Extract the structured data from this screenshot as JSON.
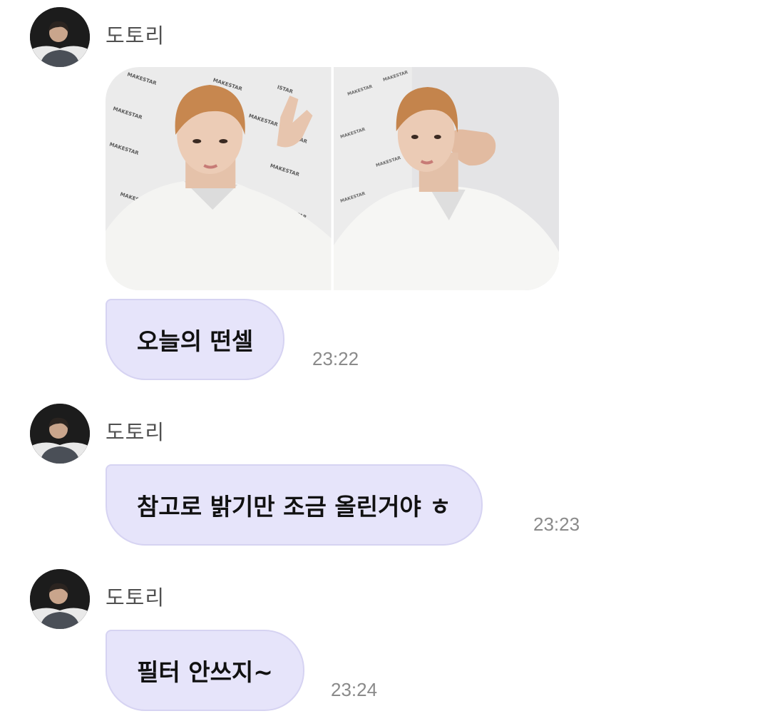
{
  "messages": [
    {
      "sender": "도토리",
      "avatar_icon": "profile-avatar",
      "photos": [
        "selfie-peace-sign",
        "selfie-fist-pose"
      ],
      "text": "오늘의 떤셀",
      "time": "23:22"
    },
    {
      "sender": "도토리",
      "avatar_icon": "profile-avatar",
      "text": "참고로 밝기만 조금 올린거야 ㅎ",
      "time": "23:23"
    },
    {
      "sender": "도토리",
      "avatar_icon": "profile-avatar",
      "text": "필터 안쓰지~",
      "time": "23:24"
    }
  ],
  "colors": {
    "bubble_bg": "#e6e4fa",
    "bubble_border": "#d6d3f2",
    "sender_text": "#505050",
    "time_text": "#8a8a8a"
  }
}
